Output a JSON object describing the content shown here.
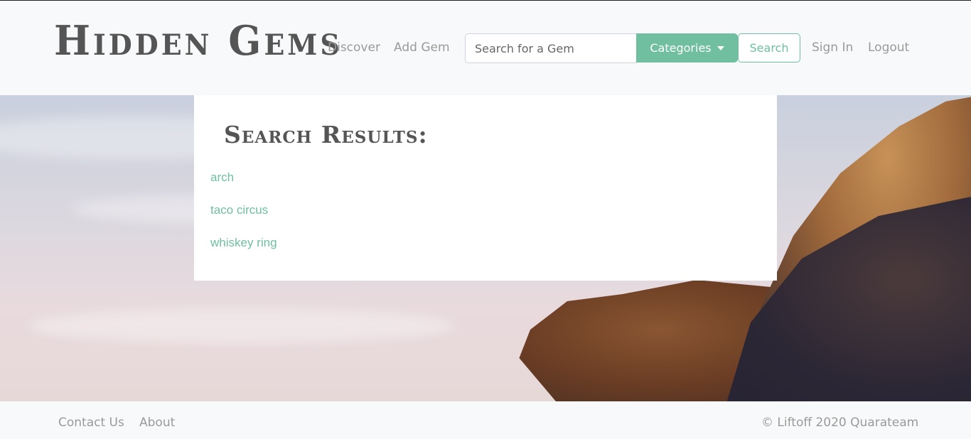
{
  "brand": {
    "title": "Hidden Gems"
  },
  "nav": {
    "discover": "Discover",
    "add_gem": "Add Gem",
    "search_placeholder": "Search for a Gem",
    "categories": "Categories",
    "search_button": "Search",
    "sign_in": "Sign In",
    "logout": "Logout"
  },
  "results": {
    "title": "Search Results:",
    "items": [
      "arch",
      "taco circus",
      "whiskey ring"
    ]
  },
  "footer": {
    "contact": "Contact Us",
    "about": "About",
    "copyright": "© Liftoff 2020 Quarateam"
  },
  "colors": {
    "accent": "#6fbfa0",
    "nav_text": "#9a9a9a",
    "brand_text": "#555555",
    "background": "#f8f9fa"
  },
  "icons": {
    "categories_caret": "caret-down-icon"
  }
}
